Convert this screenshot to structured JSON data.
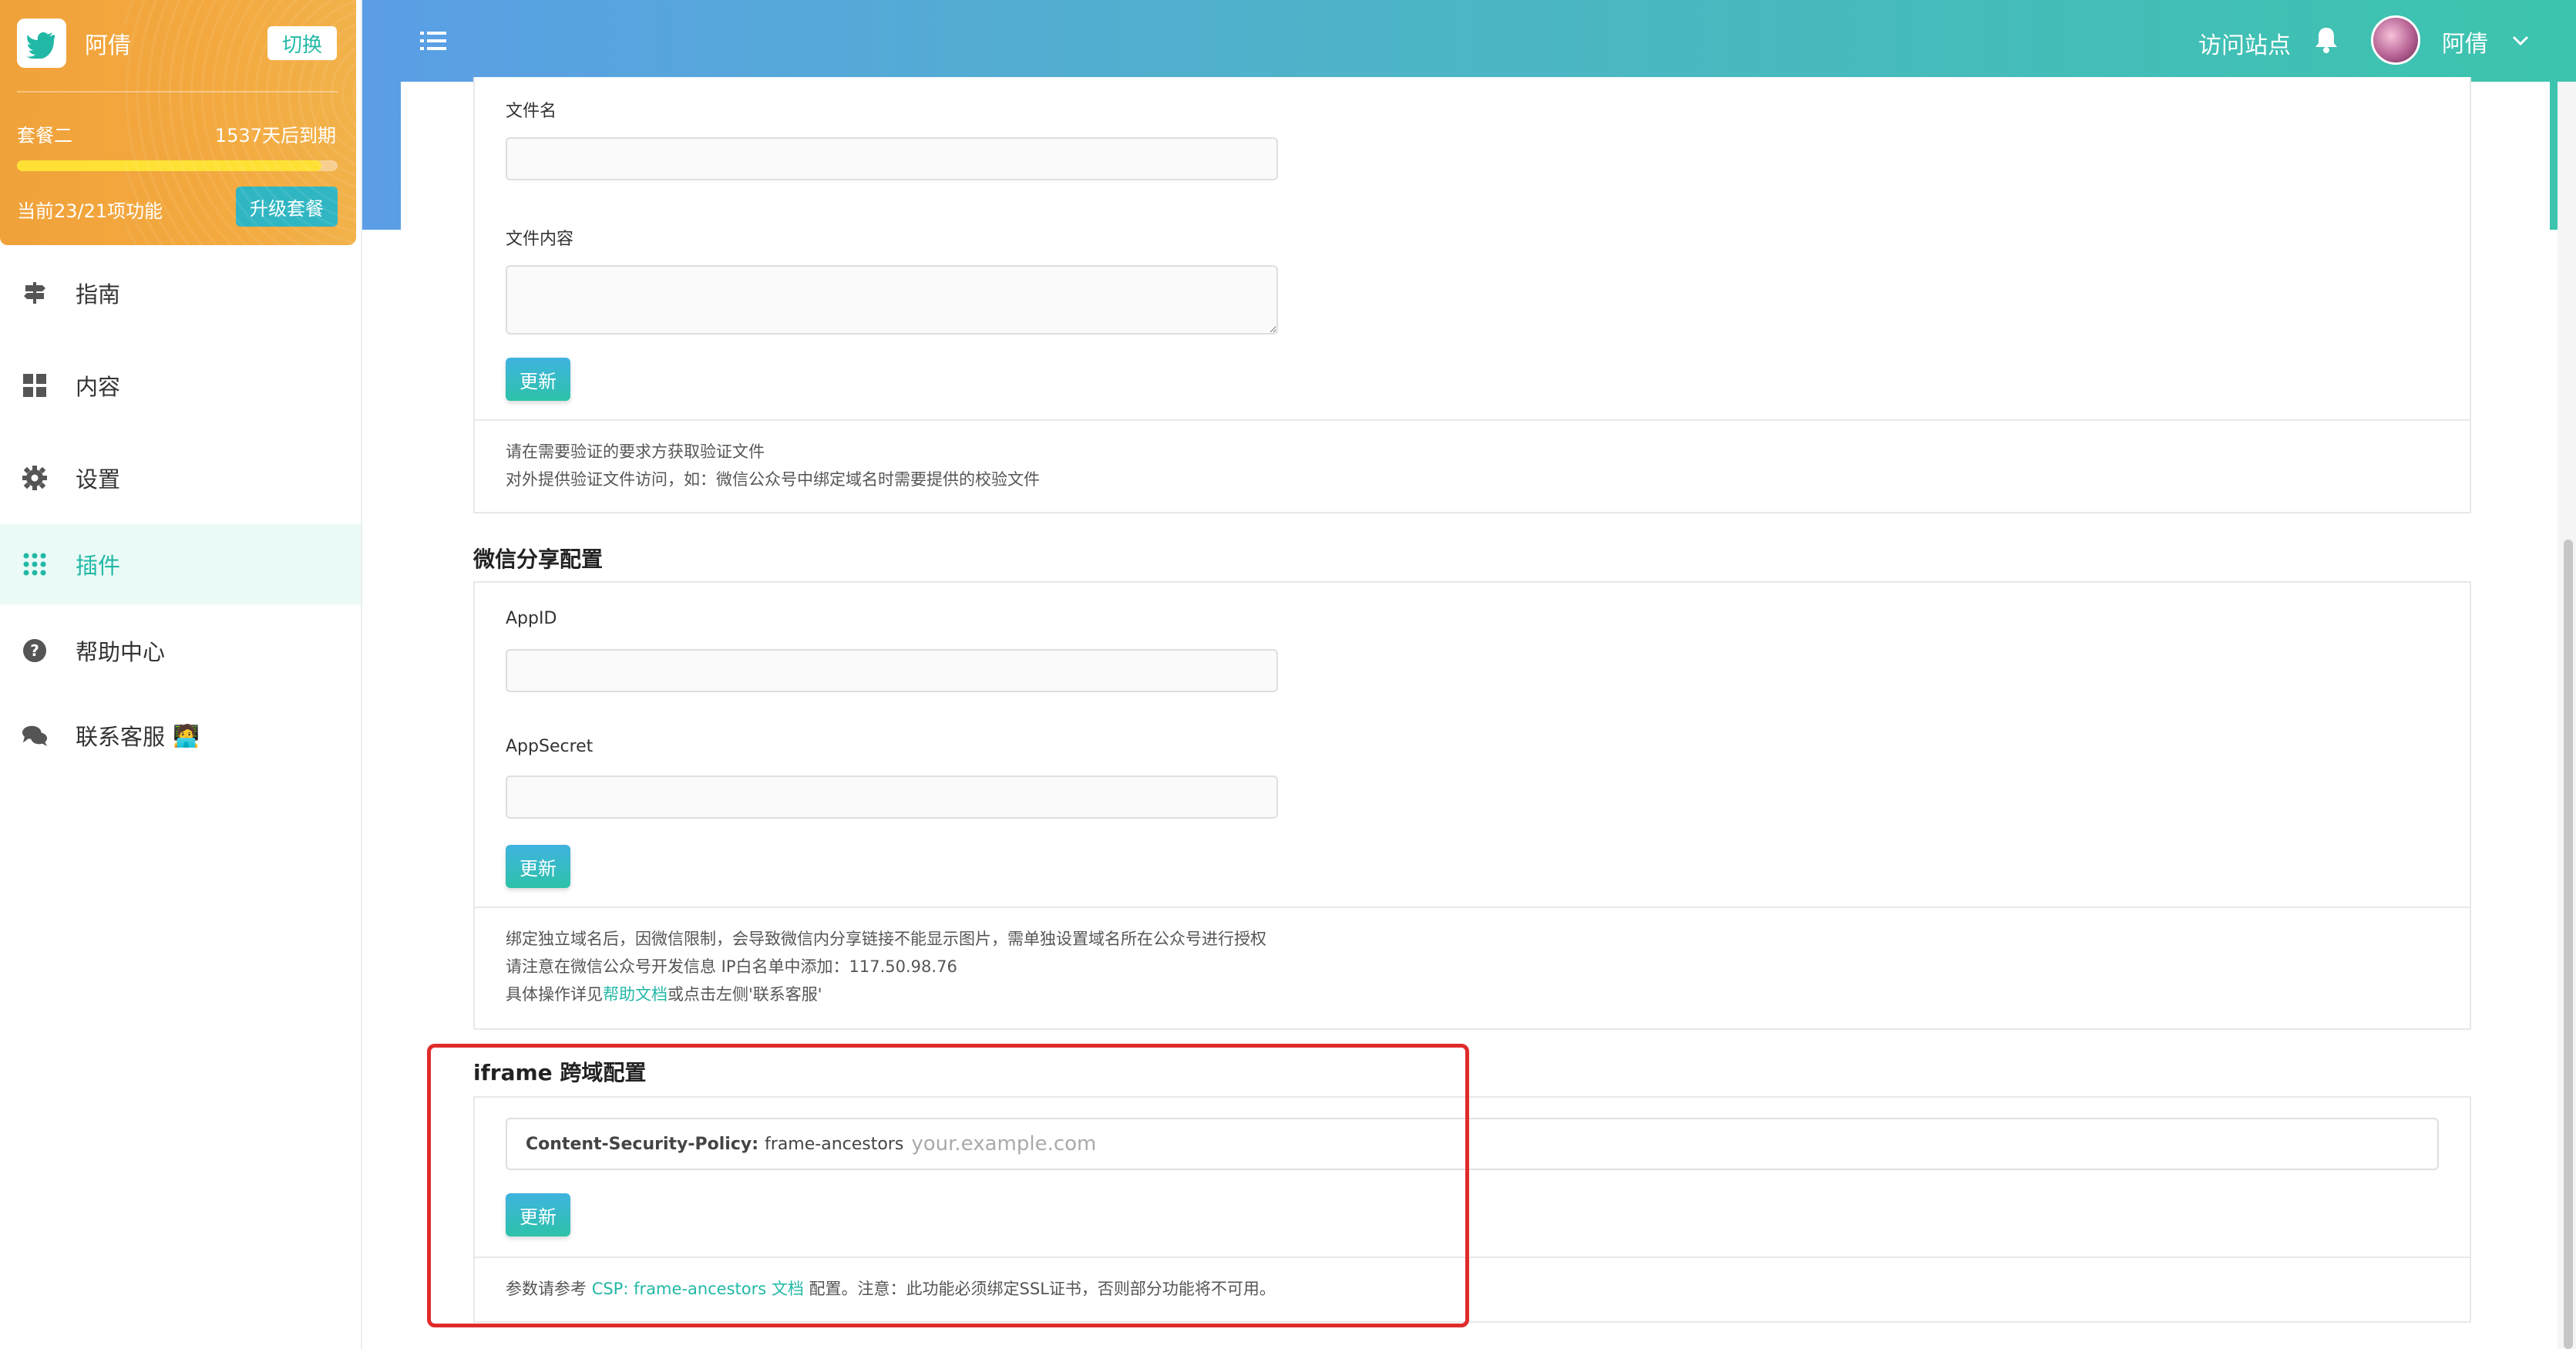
{
  "sidebar": {
    "plan": {
      "name": "阿倩",
      "switch_label": "切换",
      "tier": "套餐二",
      "expire": "1537天后到期",
      "progress": 0.95,
      "usage": "当前23/21项功能",
      "upgrade_label": "升级套餐"
    },
    "items": [
      {
        "label": "指南",
        "icon": "signpost-icon"
      },
      {
        "label": "内容",
        "icon": "grid-icon"
      },
      {
        "label": "设置",
        "icon": "gear-icon"
      },
      {
        "label": "插件",
        "icon": "apps-icon",
        "active": true
      },
      {
        "label": "帮助中心",
        "icon": "question-icon"
      },
      {
        "label": "联系客服",
        "icon": "chat-icon",
        "suffix": "🧑‍💻"
      }
    ]
  },
  "header": {
    "visit_label": "访问站点",
    "user_name": "阿倩"
  },
  "verify_section": {
    "filename_label": "文件名",
    "filename_value": "",
    "content_label": "文件内容",
    "content_value": "",
    "update_label": "更新",
    "note_line1": "请在需要验证的要求方获取验证文件",
    "note_line2": "对外提供验证文件访问，如：微信公众号中绑定域名时需要提供的校验文件"
  },
  "wechat_section": {
    "title": "微信分享配置",
    "appid_label": "AppID",
    "appid_value": "",
    "appsecret_label": "AppSecret",
    "appsecret_value": "",
    "update_label": "更新",
    "note_line1": "绑定独立域名后，因微信限制，会导致微信内分享链接不能显示图片，需单独设置域名所在公众号进行授权",
    "note_line2": "请注意在微信公众号开发信息 IP白名单中添加：117.50.98.76",
    "note_line3_prefix": "具体操作详见",
    "note_line3_link": "帮助文档",
    "note_line3_suffix": "或点击左侧'联系客服'"
  },
  "iframe_section": {
    "title": "iframe 跨域配置",
    "csp_key": "Content-Security-Policy:",
    "csp_value": "frame-ancestors",
    "csp_placeholder": "your.example.com",
    "update_label": "更新",
    "note_prefix": "参数请参考 ",
    "note_link": "CSP: frame-ancestors 文档",
    "note_suffix": " 配置。注意：此功能必须绑定SSL证书，否则部分功能将不可用。"
  },
  "colors": {
    "accent": "#22b8a6",
    "plan_bg": "#f0a23a",
    "highlight": "#e02b2b"
  }
}
